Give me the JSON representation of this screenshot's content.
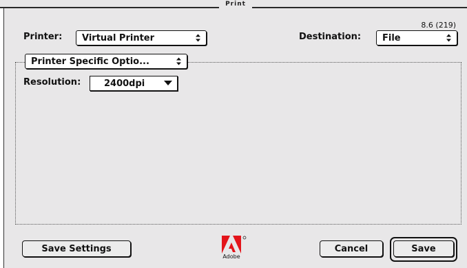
{
  "window": {
    "title": "Print",
    "version": "8.6 (219)"
  },
  "printer": {
    "label": "Printer:",
    "value": "Virtual Printer"
  },
  "destination": {
    "label": "Destination:",
    "value": "File"
  },
  "options_panel": {
    "value": "Printer Specific Optio..."
  },
  "resolution": {
    "label": "Resolution:",
    "value": "2400dpi"
  },
  "buttons": {
    "save_settings": "Save Settings",
    "cancel": "Cancel",
    "save": "Save"
  },
  "logo": {
    "text": "Adobe",
    "color": "#e3141a"
  }
}
